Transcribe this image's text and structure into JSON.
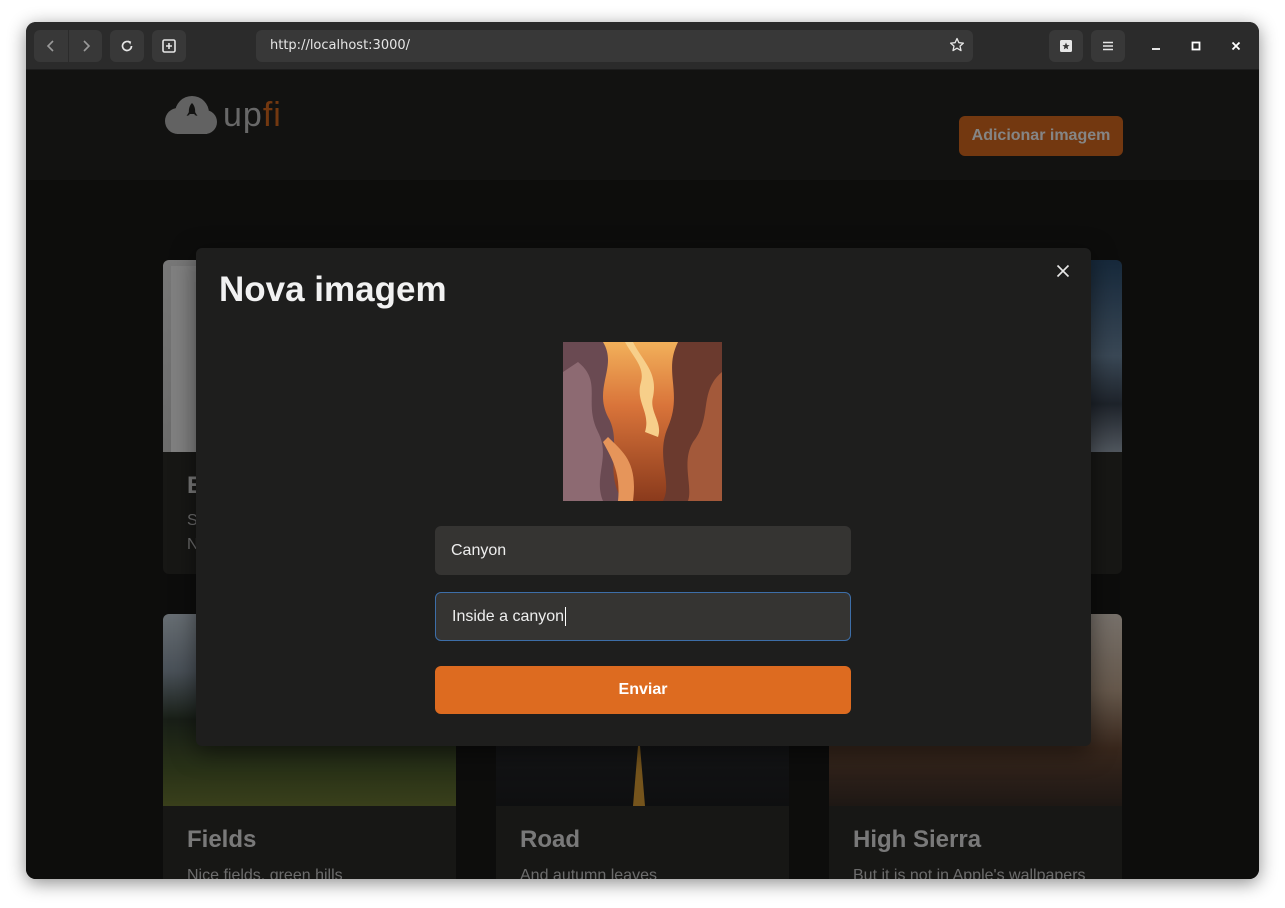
{
  "browser": {
    "url": "http://localhost:3000/"
  },
  "header": {
    "logo_up": "up",
    "logo_fi": "fi",
    "add_button": "Adicionar imagem"
  },
  "cards": [
    {
      "title": "E",
      "desc_line1": "S",
      "desc_line2": "N"
    },
    {
      "title": "",
      "desc": ""
    },
    {
      "title": "",
      "desc": ""
    },
    {
      "title": "Fields",
      "desc": "Nice fields, green hills"
    },
    {
      "title": "Road",
      "desc": "And autumn leaves"
    },
    {
      "title": "High Sierra",
      "desc": "But it is not in Apple's wallpapers"
    }
  ],
  "modal": {
    "title": "Nova imagem",
    "title_field_value": "Canyon",
    "description_field_value": "Inside a canyon",
    "submit_label": "Enviar"
  },
  "colors": {
    "accent": "#dd6b20",
    "focus_border": "#3d6ea8"
  }
}
